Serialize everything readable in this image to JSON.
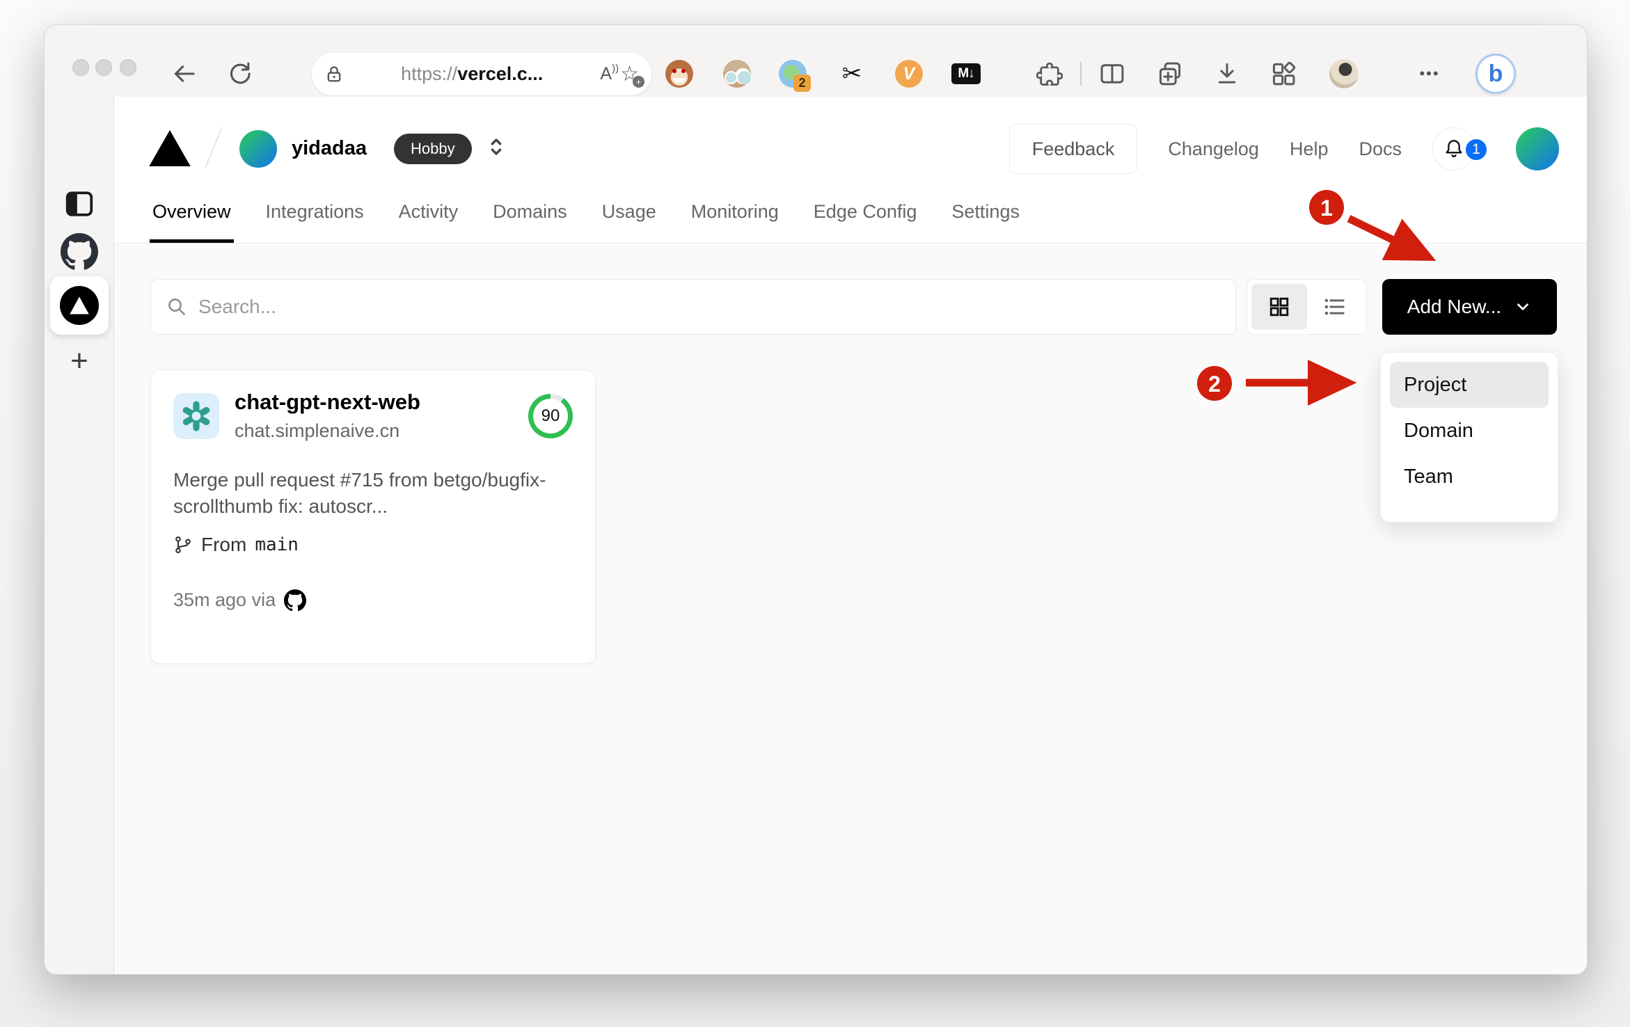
{
  "browser": {
    "address": {
      "scheme": "https://",
      "host": "vercel.c...",
      "read_aloud": "A"
    },
    "extensions": {
      "badge_count": "2",
      "scissors_glyph": "✂",
      "vimium_label": "V",
      "markdown_label": "M↓"
    },
    "ellipsis_menu": "•••",
    "bing_label": "b"
  },
  "sidebar": {
    "plus_label": "+"
  },
  "dash": {
    "separator": "/",
    "team_name": "yidadaa",
    "plan_badge": "Hobby",
    "links": {
      "feedback": "Feedback",
      "changelog": "Changelog",
      "help": "Help",
      "docs": "Docs"
    },
    "notifications": "1",
    "tabs": [
      {
        "label": "Overview"
      },
      {
        "label": "Integrations"
      },
      {
        "label": "Activity"
      },
      {
        "label": "Domains"
      },
      {
        "label": "Usage"
      },
      {
        "label": "Monitoring"
      },
      {
        "label": "Edge Config"
      },
      {
        "label": "Settings"
      }
    ],
    "search_placeholder": "Search...",
    "add_new_label": "Add New...",
    "menu": {
      "project": "Project",
      "domain": "Domain",
      "team": "Team"
    },
    "card": {
      "name": "chat-gpt-next-web",
      "domain": "chat.simplenaive.cn",
      "score": "90",
      "commit": "Merge pull request #715 from betgo/bugfix-scrollthumb fix: autoscr...",
      "branch_label": "From",
      "branch_name": "main",
      "meta": "35m ago via"
    }
  },
  "annotations": {
    "step1": "1",
    "step2": "2"
  },
  "colors": {
    "annotation_red": "#d11f0d",
    "badge_blue": "#0b6ef5",
    "score_green": "#2fbe52",
    "openai_teal": "#2e9e8f",
    "button_black": "#000000"
  }
}
